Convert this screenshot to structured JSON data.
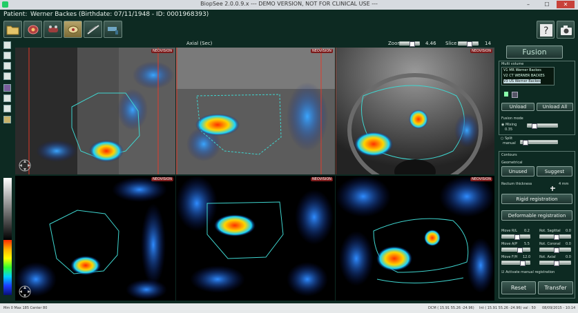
{
  "window": {
    "title": "BiopSee 2.0.0.9.x   ---  DEMO VERSION, NOT FOR CLINICAL USE  ---",
    "min_glyph": "–",
    "max_glyph": "☐",
    "close_glyph": "✕"
  },
  "patient": {
    "label": "Patient:",
    "text": "Werner Backes (Birthdate: 07/11/1948 - ID: 0001968393)"
  },
  "toolbar": {
    "help_label": "?"
  },
  "viewheader": {
    "plane_label": "Axial (Sec)",
    "zoom_label": "Zoom",
    "zoom_value": "4.46",
    "slice_label": "Slice",
    "slice_value": "14"
  },
  "viewports": {
    "brand": "NEOVISION",
    "vp1_letter_left": "R",
    "vp1_letter_right": "L"
  },
  "rightpanel": {
    "fusion_label": "Fusion",
    "multivolume_label": "Multi volume",
    "volumes": [
      "V1 MR Werner Backes",
      "V2 CT WERNER BACKES",
      "V3 US Werner Backes"
    ],
    "unload_label": "Unload",
    "unload_all_label": "Unload All",
    "fusion_mode_label": "Fusion mode",
    "mixing_label": "Mixing",
    "mixing_value": "0.35",
    "split_label": "Split",
    "manual_label": "manual",
    "contours_label": "Contours",
    "geometrical_label": "Geometrical",
    "unused_label": "Unused",
    "suggest_label": "Suggest",
    "rectum_label": "Rectum thickness",
    "rectum_value": "4 mm",
    "rigid_label": "Rigid registration",
    "deformable_label": "Deformable registration",
    "moves": [
      {
        "label": "Move R/L",
        "value": "0.2"
      },
      {
        "label": "Rot. Sagittal",
        "value": "0.0"
      },
      {
        "label": "Move A/P",
        "value": "5.5"
      },
      {
        "label": "Rot. Coronal",
        "value": "0.0"
      },
      {
        "label": "Move F/H",
        "value": "12.0"
      },
      {
        "label": "Rot. Axial",
        "value": "0.0"
      }
    ],
    "activate_label": "Activate manual registration",
    "reset_label": "Reset",
    "transfer_label": "Transfer"
  },
  "status": {
    "left": "Mm    0  Max  185  Center  80",
    "dicom": "DCM  ( 15.91  55.26  -24.96)",
    "int": "Int  ( 15.91  55.26  -24.96)  val :   50",
    "datetime": "08/09/2015  -  10:14"
  },
  "colors": {
    "background": "#0d2a22",
    "contour": "#3fd6d0",
    "accent_red": "#e23a2a"
  }
}
